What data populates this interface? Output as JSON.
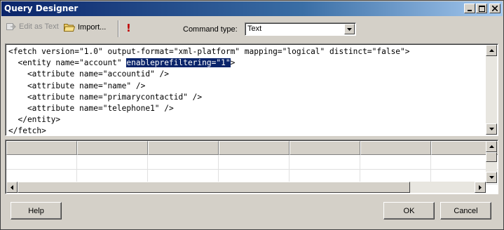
{
  "window": {
    "title": "Query Designer"
  },
  "toolbar": {
    "edit_as_text": "Edit as Text",
    "import": "Import...",
    "command_type_label": "Command type:",
    "command_type_value": "Text"
  },
  "editor": {
    "line1": "<fetch version=\"1.0\" output-format=\"xml-platform\" mapping=\"logical\" distinct=\"false\">",
    "line2_pre": "  <entity name=\"account\" ",
    "line2_hl": "enableprefiltering=\"1\"",
    "line2_post": ">",
    "line3": "    <attribute name=\"accountid\" />",
    "line4": "    <attribute name=\"name\" />",
    "line5": "    <attribute name=\"primarycontactid\" />",
    "line6": "    <attribute name=\"telephone1\" />",
    "line7": "  </entity>",
    "line8": "</fetch>"
  },
  "buttons": {
    "help": "Help",
    "ok": "OK",
    "cancel": "Cancel"
  },
  "icons": {
    "titlebar": [
      "minimize-icon",
      "maximize-icon",
      "close-icon"
    ],
    "toolbar": [
      "edit-as-text-icon",
      "folder-icon",
      "run-exclamation-icon",
      "chevron-down-icon"
    ]
  },
  "colors": {
    "titlebar_start": "#0a246a",
    "selection": "#0a246a",
    "run_icon": "#c00000",
    "window_bg": "#d4d0c8"
  }
}
